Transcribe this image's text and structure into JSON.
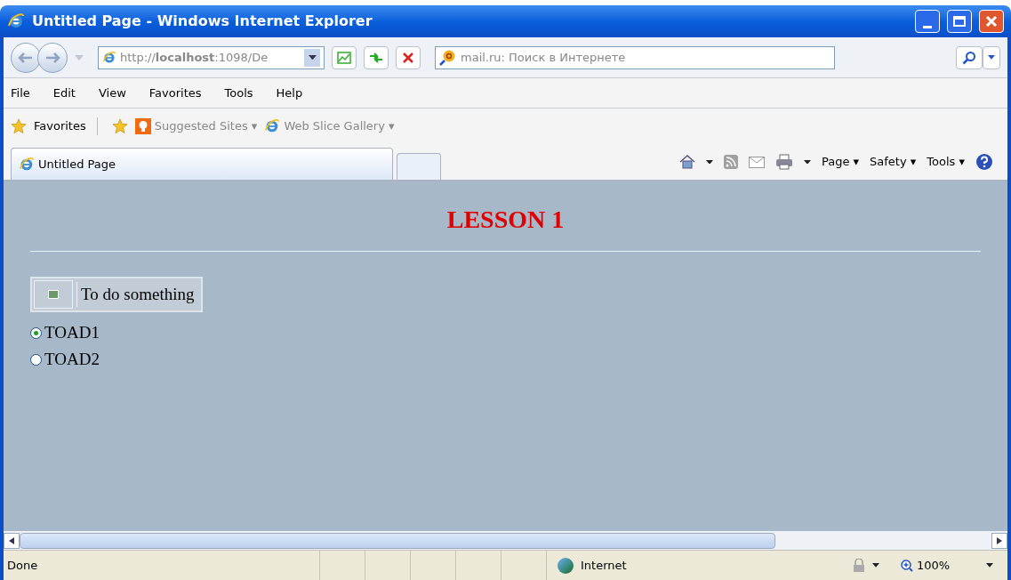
{
  "window": {
    "title": "Untitled Page - Windows Internet Explorer"
  },
  "address_bar": {
    "url": "http://**localhost**:1098/De"
  },
  "search": {
    "placeholder": "mail.ru: Поиск в Интернете"
  },
  "menu": [
    "File",
    "Edit",
    "View",
    "Favorites",
    "Tools",
    "Help"
  ],
  "favorites_bar": {
    "label": "Favorites",
    "links": [
      {
        "label": "Suggested Sites ▾",
        "kind": "bulb"
      },
      {
        "label": "Web Slice Gallery ▾",
        "kind": "ie"
      }
    ]
  },
  "tabs": [
    {
      "label": "Untitled Page",
      "selected": true
    }
  ],
  "command_bar": [
    "Page ▾",
    "Safety ▾",
    "Tools ▾"
  ],
  "page": {
    "heading": "LESSON 1",
    "button": "To do something",
    "radios": [
      {
        "label": "TOAD1",
        "selected": true
      },
      {
        "label": "TOAD2",
        "selected": false
      }
    ]
  },
  "status_bar": {
    "status": "Done",
    "zone": "Internet",
    "zoom": "100%"
  }
}
